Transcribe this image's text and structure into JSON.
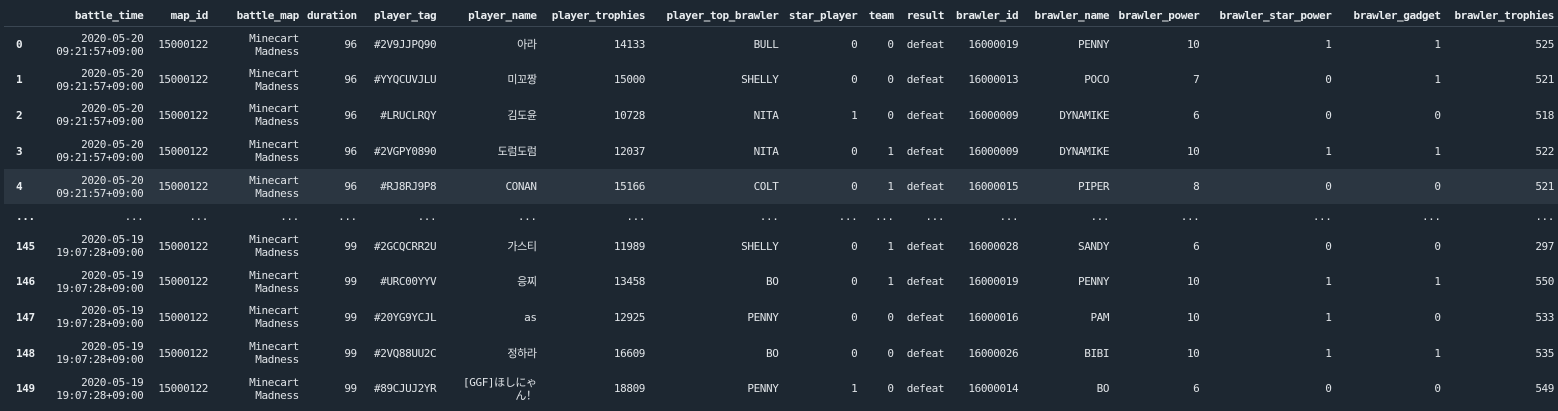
{
  "table": {
    "index_header": "",
    "columns": [
      "battle_time",
      "map_id",
      "battle_map",
      "duration",
      "player_tag",
      "player_name",
      "player_trophies",
      "player_top_brawler",
      "star_player",
      "team",
      "result",
      "brawler_id",
      "brawler_name",
      "brawler_power",
      "brawler_star_power",
      "brawler_gadget",
      "brawler_trophies"
    ],
    "rows": [
      {
        "index": "0",
        "cells": [
          "2020-05-20 09:21:57+09:00",
          "15000122",
          "Minecart Madness",
          "96",
          "#2V9JJPQ90",
          "아라",
          "14133",
          "BULL",
          "0",
          "0",
          "defeat",
          "16000019",
          "PENNY",
          "10",
          "1",
          "1",
          "525"
        ]
      },
      {
        "index": "1",
        "cells": [
          "2020-05-20 09:21:57+09:00",
          "15000122",
          "Minecart Madness",
          "96",
          "#YYQCUVJLU",
          "미꼬짱",
          "15000",
          "SHELLY",
          "0",
          "0",
          "defeat",
          "16000013",
          "POCO",
          "7",
          "0",
          "1",
          "521"
        ]
      },
      {
        "index": "2",
        "cells": [
          "2020-05-20 09:21:57+09:00",
          "15000122",
          "Minecart Madness",
          "96",
          "#LRUCLRQY",
          "김도윤",
          "10728",
          "NITA",
          "1",
          "0",
          "defeat",
          "16000009",
          "DYNAMIKE",
          "6",
          "0",
          "0",
          "518"
        ]
      },
      {
        "index": "3",
        "cells": [
          "2020-05-20 09:21:57+09:00",
          "15000122",
          "Minecart Madness",
          "96",
          "#2VGPY0890",
          "도럼도럼",
          "12037",
          "NITA",
          "0",
          "1",
          "defeat",
          "16000009",
          "DYNAMIKE",
          "10",
          "1",
          "1",
          "522"
        ]
      },
      {
        "index": "4",
        "cells": [
          "2020-05-20 09:21:57+09:00",
          "15000122",
          "Minecart Madness",
          "96",
          "#RJ8RJ9P8",
          "CONAN",
          "15166",
          "COLT",
          "0",
          "1",
          "defeat",
          "16000015",
          "PIPER",
          "8",
          "0",
          "0",
          "521"
        ]
      },
      {
        "index": "...",
        "cells": [
          "...",
          "...",
          "...",
          "...",
          "...",
          "...",
          "...",
          "...",
          "...",
          "...",
          "...",
          "...",
          "...",
          "...",
          "...",
          "...",
          "..."
        ]
      },
      {
        "index": "145",
        "cells": [
          "2020-05-19 19:07:28+09:00",
          "15000122",
          "Minecart Madness",
          "99",
          "#2GCQCRR2U",
          "가스티",
          "11989",
          "SHELLY",
          "0",
          "1",
          "defeat",
          "16000028",
          "SANDY",
          "6",
          "0",
          "0",
          "297"
        ]
      },
      {
        "index": "146",
        "cells": [
          "2020-05-19 19:07:28+09:00",
          "15000122",
          "Minecart Madness",
          "99",
          "#URC00YYV",
          "응찌",
          "13458",
          "BO",
          "0",
          "1",
          "defeat",
          "16000019",
          "PENNY",
          "10",
          "1",
          "1",
          "550"
        ]
      },
      {
        "index": "147",
        "cells": [
          "2020-05-19 19:07:28+09:00",
          "15000122",
          "Minecart Madness",
          "99",
          "#20YG9YCJL",
          "as",
          "12925",
          "PENNY",
          "0",
          "0",
          "defeat",
          "16000016",
          "PAM",
          "10",
          "1",
          "0",
          "533"
        ]
      },
      {
        "index": "148",
        "cells": [
          "2020-05-19 19:07:28+09:00",
          "15000122",
          "Minecart Madness",
          "99",
          "#2VQ88UU2C",
          "정하라",
          "16609",
          "BO",
          "0",
          "0",
          "defeat",
          "16000026",
          "BIBI",
          "10",
          "1",
          "1",
          "535"
        ]
      },
      {
        "index": "149",
        "cells": [
          "2020-05-19 19:07:28+09:00",
          "15000122",
          "Minecart Madness",
          "99",
          "#89CJUJ2YR",
          "[GGF]ほしにゃん！",
          "18809",
          "PENNY",
          "1",
          "0",
          "defeat",
          "16000014",
          "BO",
          "6",
          "0",
          "0",
          "549"
        ]
      }
    ]
  }
}
